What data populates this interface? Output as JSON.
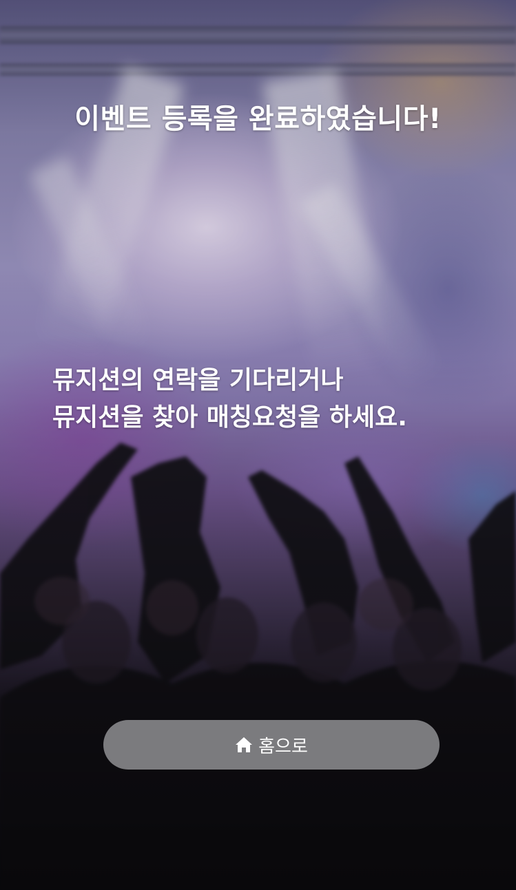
{
  "title": "이벤트 등록을 완료하였습니다!",
  "message": {
    "line1": "뮤지션의 연락을 기다리거나",
    "line2": "뮤지션을 찾아 매칭요청을 하세요."
  },
  "home_button": {
    "label": "홈으로",
    "icon": "home-icon"
  }
}
